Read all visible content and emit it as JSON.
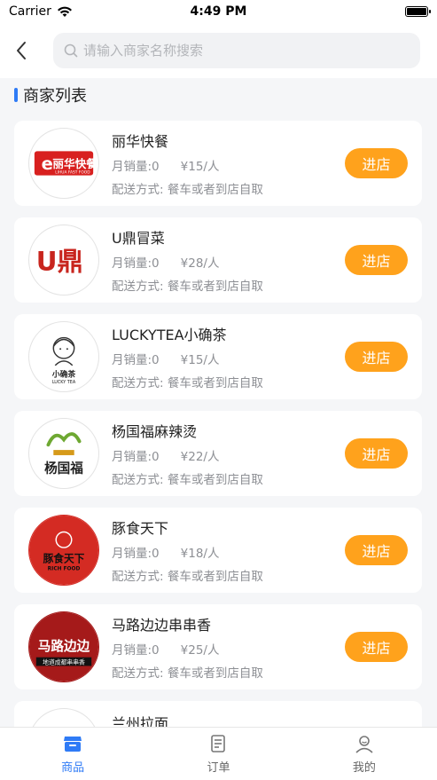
{
  "status_bar": {
    "carrier": "Carrier",
    "time": "4:49 PM"
  },
  "search": {
    "placeholder": "请输入商家名称搜索"
  },
  "section": {
    "title": "商家列表"
  },
  "shops": [
    {
      "name": "丽华快餐",
      "sales": "月销量:0",
      "price": "¥15/人",
      "delivery": "配送方式: 餐车或者到店自取",
      "button": "进店",
      "logo_text": "丽华快餐",
      "logo_sub": "LIHUA FAST FOOD"
    },
    {
      "name": "U鼎冒菜",
      "sales": "月销量:0",
      "price": "¥28/人",
      "delivery": "配送方式: 餐车或者到店自取",
      "button": "进店",
      "logo_text": "U鼎",
      "logo_sub": ""
    },
    {
      "name": "LUCKYTEA小确茶",
      "sales": "月销量:0",
      "price": "¥15/人",
      "delivery": "配送方式: 餐车或者到店自取",
      "button": "进店",
      "logo_text": "小确茶",
      "logo_sub": "LUCKY TEA"
    },
    {
      "name": "杨国福麻辣烫",
      "sales": "月销量:0",
      "price": "¥22/人",
      "delivery": "配送方式: 餐车或者到店自取",
      "button": "进店",
      "logo_text": "杨国福",
      "logo_sub": ""
    },
    {
      "name": "豚食天下",
      "sales": "月销量:0",
      "price": "¥18/人",
      "delivery": "配送方式: 餐车或者到店自取",
      "button": "进店",
      "logo_text": "豚食天下",
      "logo_sub": "RICH FOOD"
    },
    {
      "name": "马路边边串串香",
      "sales": "月销量:0",
      "price": "¥25/人",
      "delivery": "配送方式: 餐车或者到店自取",
      "button": "进店",
      "logo_text": "马路边边",
      "logo_sub": "地道成都串串香"
    },
    {
      "name": "兰州拉面",
      "sales": "",
      "price": "",
      "delivery": "",
      "button": "",
      "logo_text": "",
      "logo_sub": ""
    }
  ],
  "tabs": [
    {
      "label": "商品",
      "icon": "shop-icon",
      "active": true
    },
    {
      "label": "订单",
      "icon": "order-icon",
      "active": false
    },
    {
      "label": "我的",
      "icon": "user-icon",
      "active": false
    }
  ],
  "colors": {
    "accent": "#2f7bf6",
    "button": "#ffa21c"
  }
}
